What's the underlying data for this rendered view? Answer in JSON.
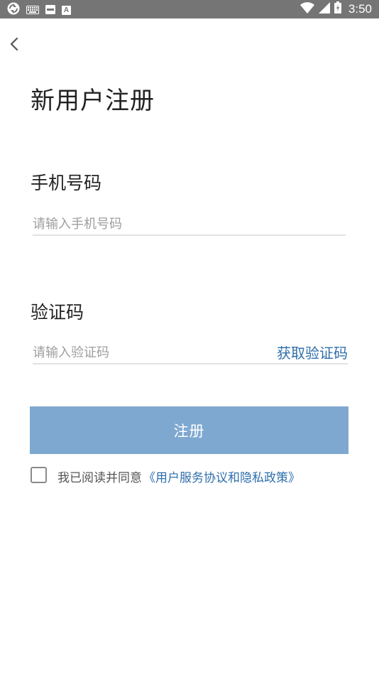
{
  "status_bar": {
    "time": "3:50",
    "notification_a_label": "A",
    "icons": [
      "sync-icon",
      "keyboard-icon",
      "mail-icon",
      "a-notification-icon",
      "wifi-icon",
      "signal-icon",
      "battery-icon"
    ]
  },
  "nav": {
    "back_icon": "chevron-left-icon"
  },
  "page": {
    "title": "新用户注册"
  },
  "phone": {
    "label": "手机号码",
    "value": "",
    "placeholder": "请输入手机号码"
  },
  "code": {
    "label": "验证码",
    "value": "",
    "placeholder": "请输入验证码",
    "get_code_label": "获取验证码"
  },
  "register_button": {
    "label": "注册"
  },
  "agreement": {
    "checked": false,
    "text": "我已阅读并同意",
    "link_text": "《用户服务协议和隐私政策》"
  },
  "colors": {
    "status_bar": "#757575",
    "accent_link": "#2f6fab",
    "button_bg": "#7ea8d0",
    "text_primary": "#222222",
    "placeholder": "#9e9e9e"
  }
}
